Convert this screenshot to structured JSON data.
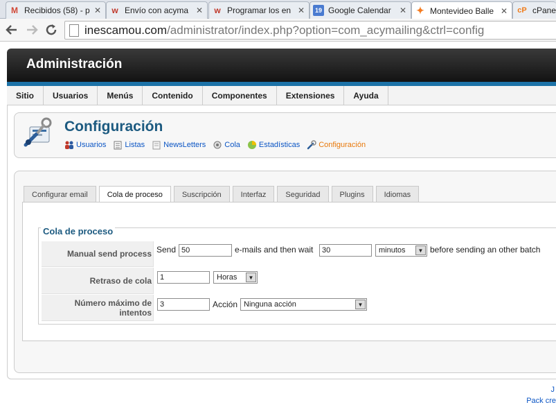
{
  "browser": {
    "tabs": [
      {
        "label": "Recibidos (58) - p",
        "icon": "M",
        "icon_color": "#d14836"
      },
      {
        "label": "Envío con acyma",
        "icon": "w",
        "icon_color": "#c0392b"
      },
      {
        "label": "Programar los en",
        "icon": "w",
        "icon_color": "#c0392b"
      },
      {
        "label": "Google Calendar",
        "icon": "19",
        "icon_color": "#4a7bd0"
      },
      {
        "label": "Montevideo Balle",
        "icon": "✦",
        "icon_color": "#f47b20"
      },
      {
        "label": "cPanel",
        "icon": "cP",
        "icon_color": "#f07b18"
      }
    ],
    "close_glyph": "✕",
    "url_host": "inescamou.com",
    "url_path": "/administrator/index.php?option=com_acymailing&ctrl=config"
  },
  "admin": {
    "title": "Administración",
    "menu": [
      "Sitio",
      "Usuarios",
      "Menús",
      "Contenido",
      "Componentes",
      "Extensiones",
      "Ayuda"
    ]
  },
  "toolbar": {
    "title": "Configuración",
    "links": [
      {
        "label": "Usuarios",
        "icon": "users-icon"
      },
      {
        "label": "Listas",
        "icon": "list-icon"
      },
      {
        "label": "NewsLetters",
        "icon": "newsletter-icon"
      },
      {
        "label": "Cola",
        "icon": "queue-icon"
      },
      {
        "label": "Estadísticas",
        "icon": "stats-icon"
      },
      {
        "label": "Configuración",
        "icon": "config-icon"
      }
    ]
  },
  "panel": {
    "tabs": [
      "Configurar email",
      "Cola de proceso",
      "Suscripción",
      "Interfaz",
      "Seguridad",
      "Plugins",
      "Idiomas"
    ],
    "active_tab": 1,
    "fieldset_legend": "Cola de proceso",
    "rows": {
      "manual": {
        "label": "Manual send process",
        "send": "Send",
        "count": "50",
        "then_wait": "e-mails and then wait",
        "wait": "30",
        "unit": "minutos",
        "tail": "before sending an other batch"
      },
      "retraso": {
        "label": "Retraso de cola",
        "value": "1",
        "unit": "Horas"
      },
      "intentos": {
        "label": "Número máximo de intentos",
        "value": "3",
        "accion_label": "Acción",
        "accion": "Ninguna acción"
      }
    }
  },
  "footer": {
    "line1": "J",
    "line2": "Pack cre"
  },
  "colors": {
    "accent": "#1c5a80",
    "header_blue": "#1d73a8",
    "link": "#0b55c4",
    "current_link": "#e8780a"
  }
}
